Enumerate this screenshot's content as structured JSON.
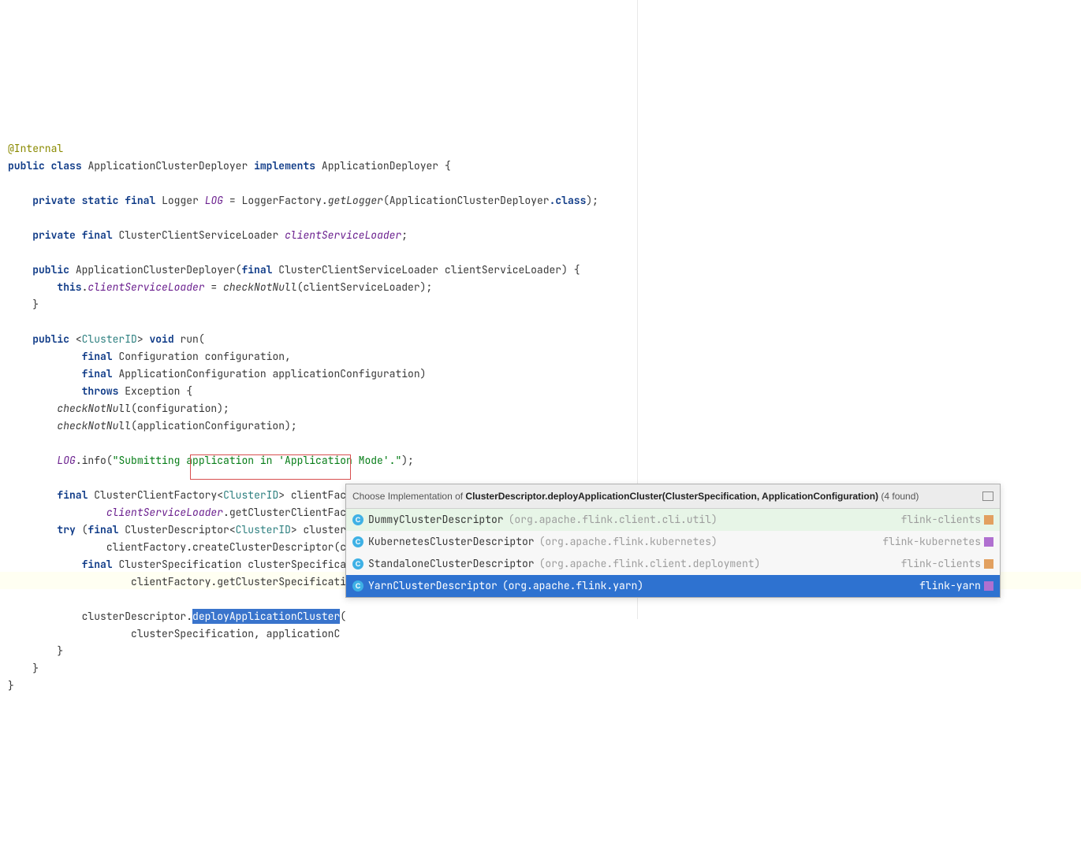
{
  "code": {
    "ann": "@Internal",
    "kw_public": "public",
    "kw_class": "class",
    "className": "ApplicationClusterDeployer",
    "kw_implements": "implements",
    "iface": "ApplicationDeployer",
    "kw_private": "private",
    "kw_static": "static",
    "kw_final": "final",
    "loggerType": "Logger",
    "loggerField": "LOG",
    "loggerFactory": "LoggerFactory",
    "getLogger": "getLogger",
    "dotClass": ".class",
    "cclType": "ClusterClientServiceLoader",
    "cclField": "clientServiceLoader",
    "ctorParam": "clientServiceLoader",
    "kw_this": "this",
    "checkNotNull": "checkNotNull",
    "generic": "ClusterID",
    "kw_void": "void",
    "runName": "run",
    "confType": "Configuration",
    "confVar": "configuration",
    "appConfType": "ApplicationConfiguration",
    "appConfVar": "applicationConfiguration",
    "kw_throws": "throws",
    "excType": "Exception",
    "infoMethod": "info",
    "infoStr": "\"Submitting application in 'Application Mode'.\"",
    "ccfType": "ClusterClientFactory",
    "clientFactoryVar": "clientFactory",
    "getCCF": "getClusterClientFactory",
    "kw_try": "try",
    "cdType": "ClusterDescriptor",
    "cdVar": "clusterDescriptor",
    "createCD": "createClusterDescriptor",
    "csType": "ClusterSpecification",
    "csVar": "clusterSpecification",
    "getCS": "getClusterSpecification",
    "deployMethod": "deployApplicationCluster",
    "openParen": "("
  },
  "popup": {
    "prefix": "Choose Implementation of ",
    "sig": "ClusterDescriptor.deployApplicationCluster(ClusterSpecification, ApplicationConfiguration)",
    "count": " (4 found)",
    "items": [
      {
        "name": "DummyClusterDescriptor",
        "pkg": "(org.apache.flink.client.cli.util)",
        "mod": "flink-clients"
      },
      {
        "name": "KubernetesClusterDescriptor",
        "pkg": "(org.apache.flink.kubernetes)",
        "mod": "flink-kubernetes"
      },
      {
        "name": "StandaloneClusterDescriptor",
        "pkg": "(org.apache.flink.client.deployment)",
        "mod": "flink-clients"
      },
      {
        "name": "YarnClusterDescriptor",
        "pkg": "(org.apache.flink.yarn)",
        "mod": "flink-yarn"
      }
    ]
  }
}
